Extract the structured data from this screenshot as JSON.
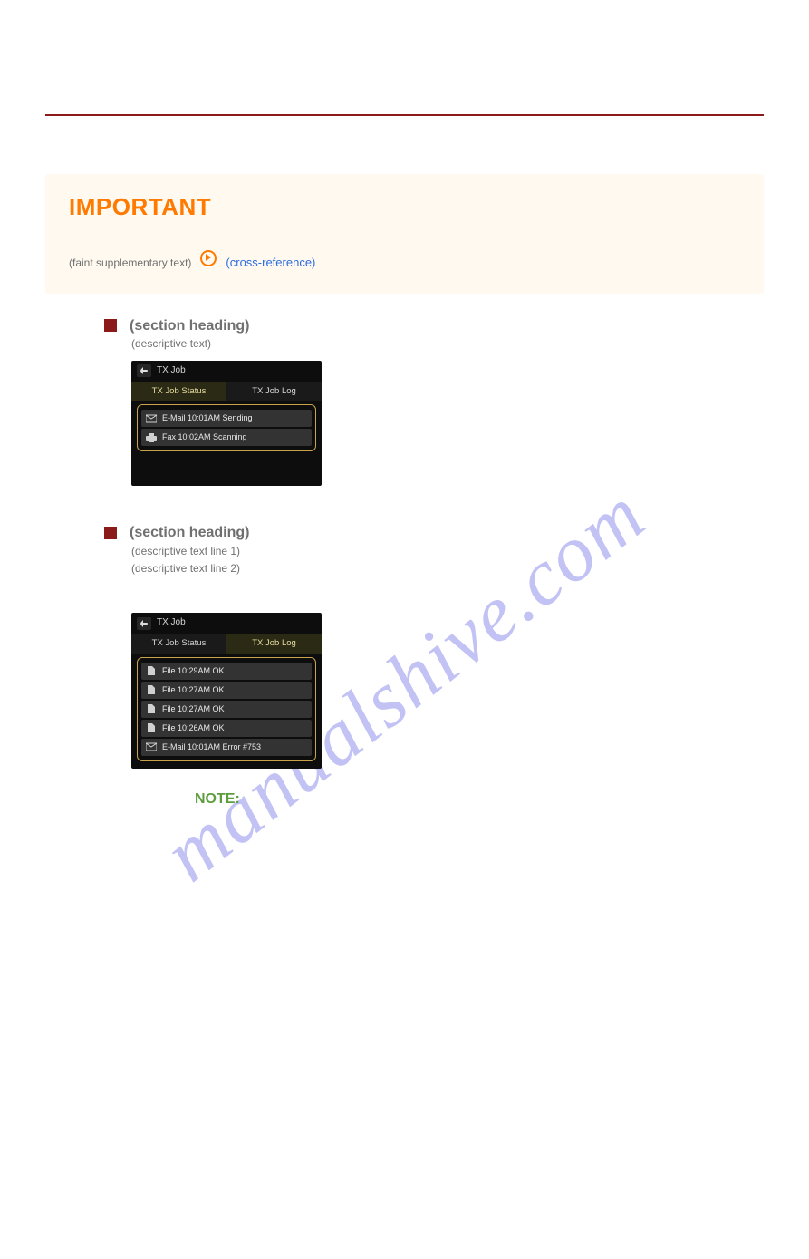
{
  "watermark": "manualshive.com",
  "important": {
    "heading": "IMPORTANT",
    "prefix_note": "(faint supplementary text)",
    "link_text": "(cross-reference)"
  },
  "sectionA": {
    "title": "(section heading)",
    "sub": "(descriptive text)",
    "screenshot": {
      "window_title": "TX Job",
      "tabs": {
        "status": "TX Job Status",
        "log": "TX Job Log",
        "active": "status"
      },
      "rows": [
        {
          "icon": "mail-icon",
          "text": "E-Mail 10:01AM Sending"
        },
        {
          "icon": "fax-icon",
          "text": "Fax 10:02AM Scanning"
        }
      ]
    }
  },
  "sectionB": {
    "title": "(section heading)",
    "sub1": "(descriptive text line 1)",
    "sub2": "(descriptive text line 2)",
    "screenshot": {
      "window_title": "TX Job",
      "tabs": {
        "status": "TX Job Status",
        "log": "TX Job Log",
        "active": "log"
      },
      "rows": [
        {
          "icon": "file-icon",
          "text": "File 10:29AM OK"
        },
        {
          "icon": "file-icon",
          "text": "File 10:27AM OK"
        },
        {
          "icon": "file-icon",
          "text": "File 10:27AM OK"
        },
        {
          "icon": "file-icon",
          "text": "File 10:26AM OK"
        },
        {
          "icon": "mail-icon",
          "text": "E-Mail 10:01AM Error #753"
        }
      ]
    }
  },
  "note_heading": "NOTE:"
}
